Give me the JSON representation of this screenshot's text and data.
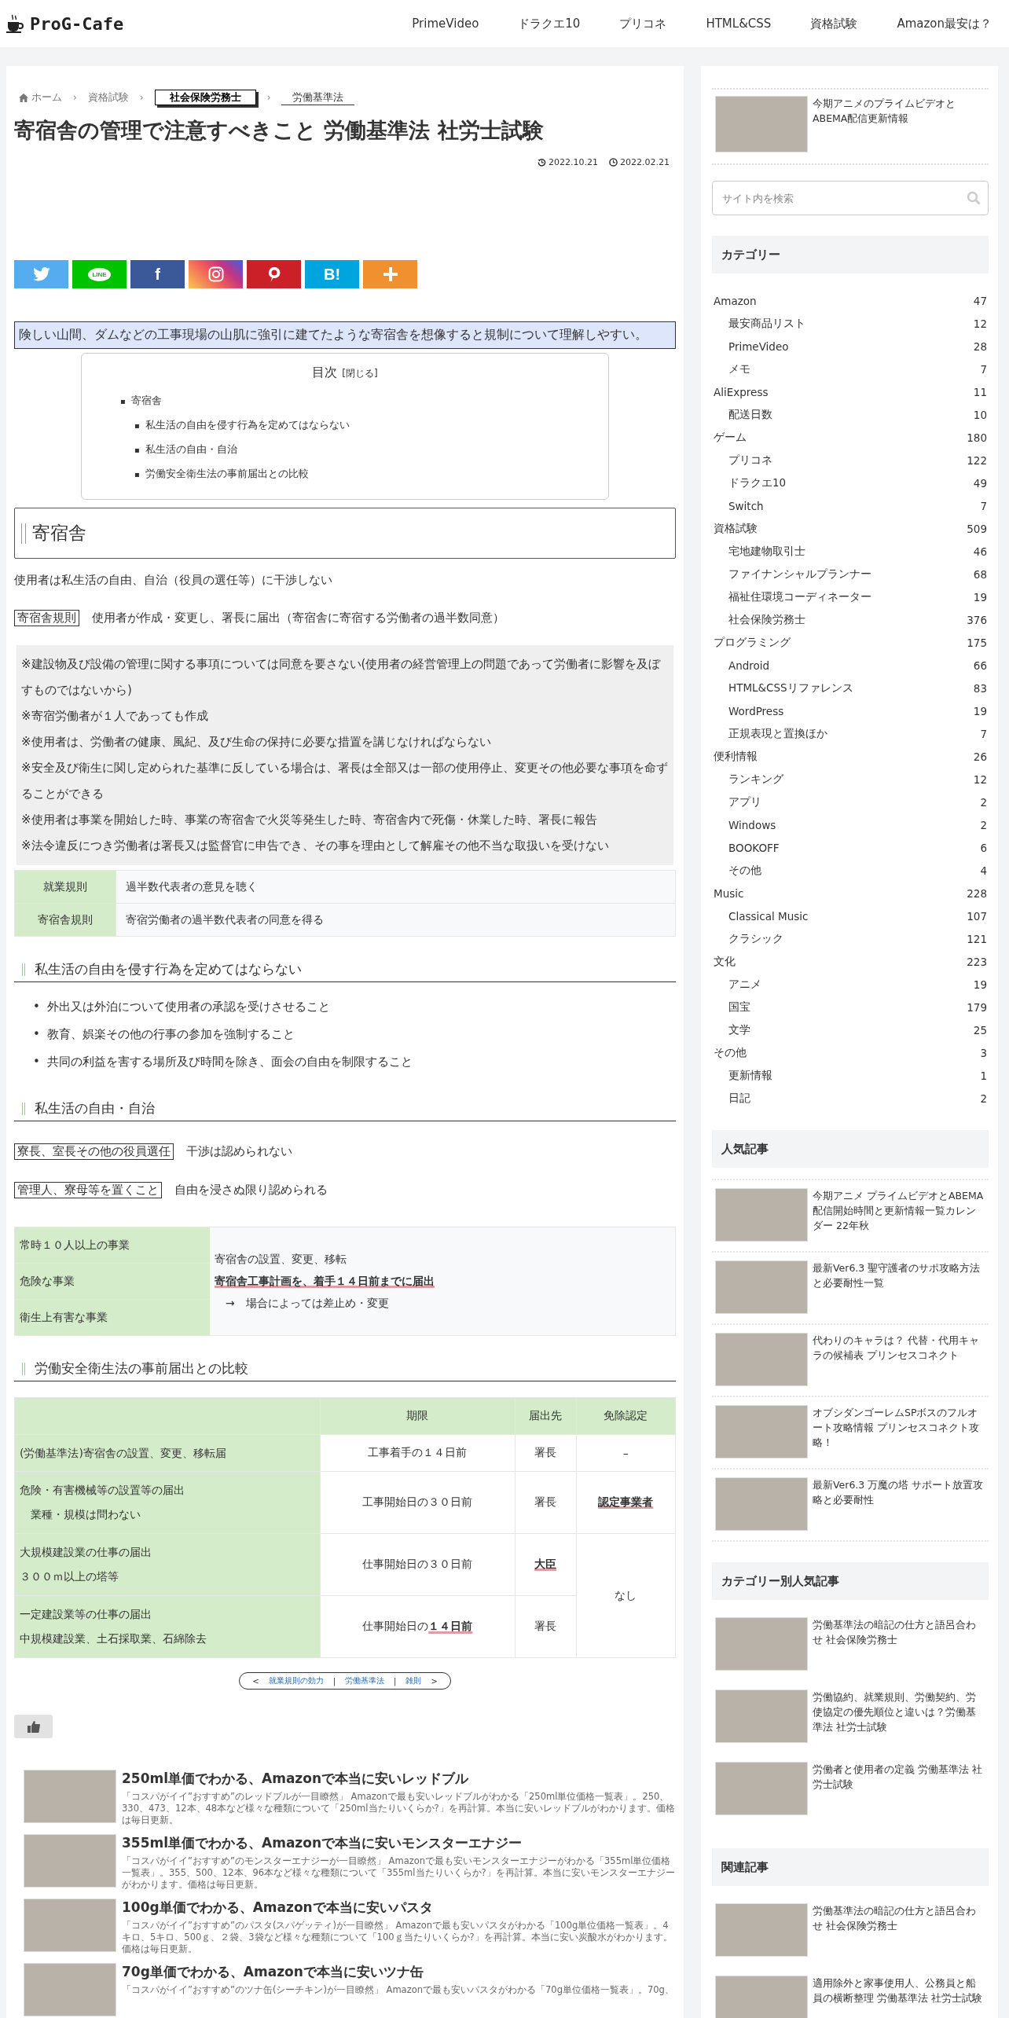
{
  "header": {
    "logo": "ProG-Cafe",
    "nav": [
      "PrimeVideo",
      "ドラクエ10",
      "プリコネ",
      "HTML&CSS",
      "資格試験",
      "Amazon最安は？"
    ]
  },
  "breadcrumbs": {
    "separator": "›",
    "items": [
      {
        "label": "ホーム",
        "kind": "home"
      },
      {
        "label": "資格試験",
        "kind": "plain"
      },
      {
        "label": "社会保険労務士",
        "kind": "boxed"
      },
      {
        "label": "労働基準法",
        "kind": "underlined"
      }
    ]
  },
  "article": {
    "title": "寄宿舎の管理で注意すべきこと 労働基準法 社労士試験",
    "updated": "2022.10.21",
    "published": "2022.02.21",
    "share_buttons": [
      {
        "kind": "twitter"
      },
      {
        "kind": "line",
        "label": "LINE"
      },
      {
        "kind": "facebook",
        "label": "f"
      },
      {
        "kind": "instagram"
      },
      {
        "kind": "pinterest"
      },
      {
        "kind": "hatena",
        "label": "B!"
      },
      {
        "kind": "more"
      }
    ],
    "callout": "険しい山間、ダムなどの工事現場の山肌に強引に建てたような寄宿舎を想像すると規制について理解しやすい。",
    "toc": {
      "title": "目次",
      "toggle": "[閉じる]",
      "marker": "▪",
      "items": [
        {
          "label": "寄宿舎",
          "children": [
            {
              "label": "私生活の自由を侵す行為を定めてはならない"
            },
            {
              "label": "私生活の自由・自治"
            },
            {
              "label": "労働安全衛生法の事前届出との比較"
            }
          ]
        }
      ]
    },
    "blocks": [
      {
        "kind": "h2",
        "text": "寄宿舎"
      },
      {
        "kind": "paragraph",
        "text": "使用者は私生活の自由、自治（役員の選任等）に干渉しない"
      },
      {
        "kind": "term",
        "label": "寄宿舎規則",
        "text": "使用者が作成・変更し、署長に届出（寄宿舎に寄宿する労働者の過半数同意）"
      },
      {
        "kind": "note_box",
        "lines": [
          "※建設物及び設備の管理に関する事項については同意を要さない(使用者の経営管理上の問題であって労働者に影響を及ぼすものではないから)",
          "※寄宿労働者が１人であっても作成",
          "※使用者は、労働者の健康、風紀、及び生命の保持に必要な措置を講じなければならない",
          "※安全及び衛生に関し定められた基準に反している場合は、署長は全部又は一部の使用停止、変更その他必要な事項を命ずることができる",
          "※使用者は事業を開始した時、事業の寄宿舎で火災等発生した時、寄宿舎内で死傷・休業した時、署長に報告",
          "※法令違反につき労働者は署長又は監督官に申告でき、その事を理由として解雇その他不当な取扱いを受けない"
        ]
      },
      {
        "kind": "def_table",
        "rows": [
          {
            "label": "就業規則",
            "text": "過半数代表者の意見を聴く"
          },
          {
            "label": "寄宿舎規則",
            "text": "寄宿労働者の過半数代表者の同意を得る"
          }
        ]
      },
      {
        "kind": "h3",
        "text": "私生活の自由を侵す行為を定めてはならない"
      },
      {
        "kind": "bullets",
        "marker": "•",
        "items": [
          "外出又は外泊について使用者の承認を受けさせること",
          "教育、娯楽その他の行事の参加を強制すること",
          "共同の利益を害する場所及び時間を除き、面会の自由を制限すること"
        ]
      },
      {
        "kind": "h3",
        "text": "私生活の自由・自治"
      },
      {
        "kind": "term",
        "label": "寮長、室長その他の役員選任",
        "text": "干渉は認められない"
      },
      {
        "kind": "term",
        "label": "管理人、寮母等を置くこと",
        "text": "自由を浸さぬ限り認められる"
      },
      {
        "kind": "split_table",
        "labels": [
          "常時１０人以上の事業",
          "危険な事業",
          "衛生上有害な事業"
        ],
        "lines": [
          {
            "text": "寄宿舎の設置、変更、移転",
            "strong": false
          },
          {
            "text": "寄宿舎工事計画を、着手１４日前までに届出",
            "strong": true
          },
          {
            "text": "　→　場合によっては差止め・変更",
            "strong": false
          }
        ]
      },
      {
        "kind": "h3",
        "text": "労働安全衛生法の事前届出との比較"
      },
      {
        "kind": "compare_table",
        "columns": [
          "期限",
          "届出先",
          "免除認定"
        ],
        "rows": [
          {
            "label": [
              "(労働基準法)寄宿舎の設置、変更、移転届"
            ],
            "cells": [
              {
                "text": "工事着手の１４日前"
              },
              {
                "text": "署長"
              },
              {
                "text": "–"
              }
            ]
          },
          {
            "label": [
              "危険・有害機械等の設置等の届出",
              "　業種・規模は問わない"
            ],
            "cells": [
              {
                "text": "工事開始日の３０日前"
              },
              {
                "text": "署長"
              },
              {
                "text": "認定事業者",
                "strong": true
              }
            ]
          },
          {
            "label": [
              "大規模建設業の仕事の届出",
              "３００ｍ以上の塔等"
            ],
            "cells": [
              {
                "text": "仕事開始日の３０日前"
              },
              {
                "text": "大臣",
                "strong": true
              },
              {
                "text": "なし",
                "rowspan": 2
              }
            ]
          },
          {
            "label": [
              "一定建設業等の仕事の届出",
              "中規模建設業、土石採取業、石綿除去"
            ],
            "cells": [
              {
                "text": "仕事開始日の**１４日前**"
              },
              {
                "text": "署長"
              }
            ]
          }
        ]
      }
    ],
    "pager": {
      "prev": "<",
      "links": [
        "就業規則の効力",
        "労働基準法",
        "雑則"
      ],
      "separator": "|",
      "next": ">"
    },
    "related": [
      {
        "title": "250ml単価でわかる、Amazonで本当に安いレッドブル",
        "excerpt": "「コスパがイイ”おすすめ”のレッドブルが一目瞭然」 Amazonで最も安いレッドブルがわかる「250ml単位価格一覧表」。250、330、473、12本、48本など様々な種類について「250ml当たりいくらか?」を再計算。本当に安いレッドブルがわかります。価格は毎日更新。"
      },
      {
        "title": "355ml単価でわかる、Amazonで本当に安いモンスターエナジー",
        "excerpt": "「コスパがイイ”おすすめ”のモンスターエナジーが一目瞭然」 Amazonで最も安いモンスターエナジーがわかる「355ml単位価格一覧表」。355、500、12本、96本など様々な種類について「355ml当たりいくらか?」を再計算。本当に安いモンスターエナジーがわかります。価格は毎日更新。"
      },
      {
        "title": "100g単価でわかる、Amazonで本当に安いパスタ",
        "excerpt": "「コスパがイイ”おすすめ”のパスタ(スパゲッティ)が一目瞭然」 Amazonで最も安いパスタがわかる「100g単位価格一覧表」。4キロ、5キロ、500ｇ、２袋、3袋など様々な種類について「100ｇ当たりいくらか?」を再計算。本当に安い炭酸水がわかります。価格は毎日更新。"
      },
      {
        "title": "70g単価でわかる、Amazonで本当に安いツナ缶",
        "excerpt": "「コスパがイイ”おすすめ”のツナ缶(シーチキン)が一目瞭然」 Amazonで最も安いパスタがわかる「70g単位価格一覧表」。70g、"
      }
    ]
  },
  "sidebar": {
    "top_post": {
      "title": "今期アニメのプライムビデオとABEMA配信更新情報"
    },
    "search": {
      "placeholder": "サイト内を検索"
    },
    "categories": {
      "title": "カテゴリー",
      "items": [
        {
          "label": "Amazon",
          "count": "47",
          "children": [
            {
              "label": "最安商品リスト",
              "count": "12"
            },
            {
              "label": "PrimeVideo",
              "count": "28"
            },
            {
              "label": "メモ",
              "count": "7"
            }
          ]
        },
        {
          "label": "AliExpress",
          "count": "11",
          "children": [
            {
              "label": "配送日数",
              "count": "10"
            }
          ]
        },
        {
          "label": "ゲーム",
          "count": "180",
          "children": [
            {
              "label": "プリコネ",
              "count": "122"
            },
            {
              "label": "ドラクエ10",
              "count": "49"
            },
            {
              "label": "Switch",
              "count": "7"
            }
          ]
        },
        {
          "label": "資格試験",
          "count": "509",
          "children": [
            {
              "label": "宅地建物取引士",
              "count": "46"
            },
            {
              "label": "ファイナンシャルプランナー",
              "count": "68"
            },
            {
              "label": "福祉住環境コーディネーター",
              "count": "19"
            },
            {
              "label": "社会保険労務士",
              "count": "376"
            }
          ]
        },
        {
          "label": "プログラミング",
          "count": "175",
          "children": [
            {
              "label": "Android",
              "count": "66"
            },
            {
              "label": "HTML&CSSリファレンス",
              "count": "83"
            },
            {
              "label": "WordPress",
              "count": "19"
            },
            {
              "label": "正規表現と置換ほか",
              "count": "7"
            }
          ]
        },
        {
          "label": "便利情報",
          "count": "26",
          "children": [
            {
              "label": "ランキング",
              "count": "12"
            },
            {
              "label": "アプリ",
              "count": "2"
            },
            {
              "label": "Windows",
              "count": "2"
            },
            {
              "label": "BOOKOFF",
              "count": "6"
            },
            {
              "label": "その他",
              "count": "4"
            }
          ]
        },
        {
          "label": "Music",
          "count": "228",
          "children": [
            {
              "label": "Classical Music",
              "count": "107"
            },
            {
              "label": "クラシック",
              "count": "121"
            }
          ]
        },
        {
          "label": "文化",
          "count": "223",
          "children": [
            {
              "label": "アニメ",
              "count": "19"
            },
            {
              "label": "国宝",
              "count": "179"
            },
            {
              "label": "文学",
              "count": "25"
            }
          ]
        },
        {
          "label": "その他",
          "count": "3",
          "children": [
            {
              "label": "更新情報",
              "count": "1"
            },
            {
              "label": "日記",
              "count": "2"
            }
          ]
        }
      ]
    },
    "sections": [
      {
        "title": "人気記事",
        "posts": [
          "今期アニメ プライムビデオとABEMA配信開始時間と更新情報一覧カレンダー 22年秋",
          "最新Ver6.3 聖守護者のサポ攻略方法と必要耐性一覧",
          "代わりのキャラは？ 代替・代用キャラの候補表 プリンセスコネクト",
          "オブシダンゴーレムSPボスのフルオート攻略情報 プリンセスコネクト攻略！",
          "最新Ver6.3 万魔の塔 サポート放置攻略と必要耐性"
        ]
      },
      {
        "title": "カテゴリー別人気記事",
        "posts": [
          "労働基準法の暗記の仕方と語呂合わせ 社会保険労務士",
          "労働協約、就業規則、労働契約、労使協定の優先順位と違いは？労働基準法 社労士試験",
          "労働者と使用者の定義 労働基準法 社労士試験"
        ]
      },
      {
        "title": "関連記事",
        "posts": [
          "労働基準法の暗記の仕方と語呂合わせ 社会保険労務士",
          "適用除外と家事使用人、公務員と船員の横断整理 労働基準法 社労士試験"
        ]
      }
    ]
  }
}
